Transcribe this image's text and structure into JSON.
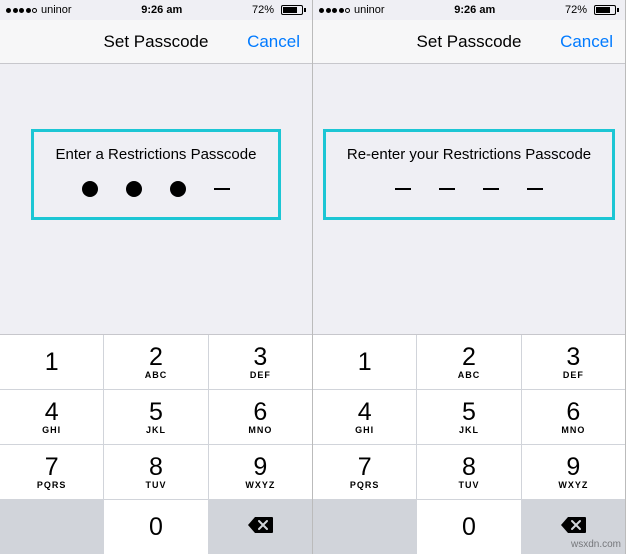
{
  "status": {
    "carrier": "uninor",
    "time": "9:26 am",
    "battery_pct": "72%"
  },
  "nav": {
    "title": "Set Passcode",
    "cancel": "Cancel"
  },
  "left": {
    "prompt": "Enter a Restrictions Passcode",
    "entered": 3,
    "total": 4
  },
  "right": {
    "prompt": "Re-enter your Restrictions Passcode",
    "entered": 0,
    "total": 4
  },
  "keys": {
    "k1": {
      "num": "1",
      "letters": ""
    },
    "k2": {
      "num": "2",
      "letters": "ABC"
    },
    "k3": {
      "num": "3",
      "letters": "DEF"
    },
    "k4": {
      "num": "4",
      "letters": "GHI"
    },
    "k5": {
      "num": "5",
      "letters": "JKL"
    },
    "k6": {
      "num": "6",
      "letters": "MNO"
    },
    "k7": {
      "num": "7",
      "letters": "PQRS"
    },
    "k8": {
      "num": "8",
      "letters": "TUV"
    },
    "k9": {
      "num": "9",
      "letters": "WXYZ"
    },
    "k0": {
      "num": "0",
      "letters": ""
    }
  },
  "watermark": "wsxdn.com"
}
